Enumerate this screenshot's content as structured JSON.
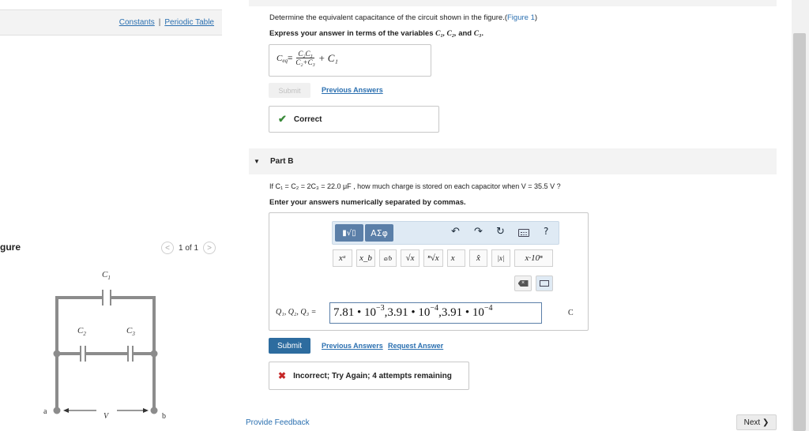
{
  "left": {
    "constants_link": "Constants",
    "separator": "|",
    "periodic_link": "Periodic Table",
    "figure_label": "gure",
    "pager": {
      "prev": "<",
      "text": "1 of 1",
      "next": ">"
    }
  },
  "circuit": {
    "c1": "C",
    "c1_sub": "1",
    "c2": "C",
    "c2_sub": "2",
    "c3": "C",
    "c3_sub": "3",
    "node_a": "a",
    "node_b": "b",
    "voltage": "V"
  },
  "part_a": {
    "question_prefix": "Determine the equivalent capacitance of the circuit shown in the figure.(",
    "figure_link": "Figure 1",
    "question_suffix": ")",
    "express_prefix": "Express your answer in terms of the variables ",
    "express_vars": "C₁, C₂,",
    "express_and": " and ",
    "express_last": "C₃",
    "express_end": ".",
    "answer_lhs": "C",
    "answer_lhs_sub": "eq",
    "answer_eq": " =",
    "frac_num": "C₂C₃",
    "frac_den": "C₂+C₃",
    "answer_tail": "+ C₁",
    "submit_label": "Submit",
    "previous_answers": "Previous Answers",
    "correct_icon": "✔",
    "correct_text": "Correct"
  },
  "part_b": {
    "triangle": "▼",
    "title": "Part B",
    "question": "If C₁ = C₂ = 2C₃ = 22.0 μF , how much charge is stored on each capacitor when V = 35.5 V ?",
    "enter_text": "Enter your answers numerically separated by commas.",
    "toolbar": {
      "templates": "▮√▯",
      "symbols": "ΑΣφ",
      "undo": "↶",
      "redo": "↷",
      "reset": "↻",
      "help": "?"
    },
    "toolbar2": [
      "xᵃ",
      "x_b",
      "a/b",
      "√x",
      "ⁿ√x",
      "x⃗",
      "x̂",
      "|x|",
      "x·10ⁿ"
    ],
    "answer_label": "Q₁, Q₂, Q₃ =",
    "answer_v1": "7.81 • 10",
    "answer_e1": "−3",
    "answer_v2": ",3.91 • 10",
    "answer_e2": "−4",
    "answer_v3": ",3.91 • 10",
    "answer_e3": "−4",
    "unit": "C",
    "submit_label": "Submit",
    "previous_answers": "Previous Answers",
    "request_answer": "Request Answer",
    "incorrect_icon": "✖",
    "incorrect_text": "Incorrect; Try Again; 4 attempts remaining"
  },
  "footer": {
    "feedback": "Provide Feedback",
    "next": "Next ❯"
  },
  "colors": {
    "link": "#2a6fb0",
    "primary_button": "#2d6c9f",
    "correct": "#3a8a3a",
    "incorrect": "#c62828"
  }
}
